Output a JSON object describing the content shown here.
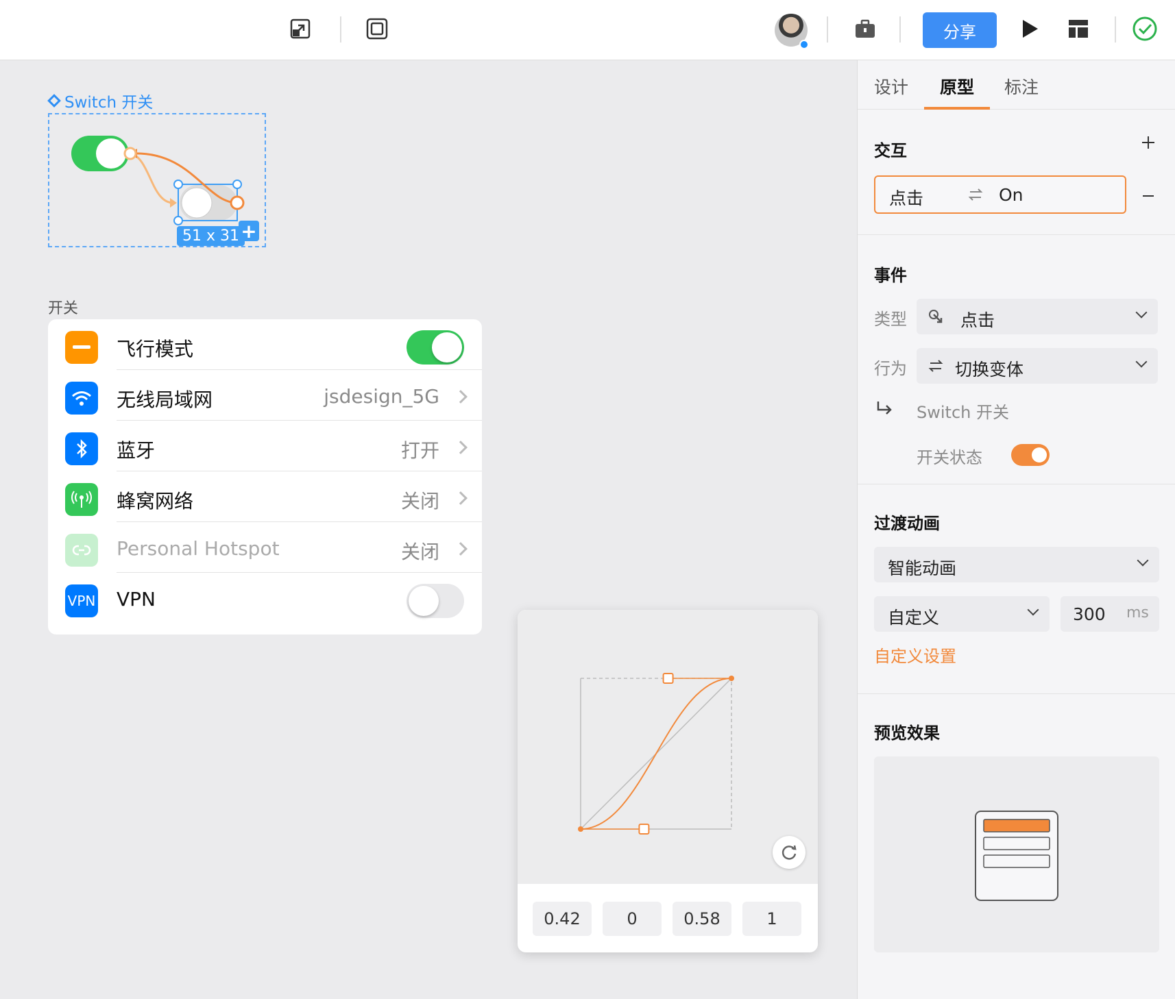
{
  "toolbar": {
    "share_label": "分享",
    "icons": [
      "resize-icon",
      "frame-icon",
      "briefcase-icon",
      "play-icon",
      "layout-icon",
      "check-circle-icon"
    ]
  },
  "canvas": {
    "frame_label": "Switch 开关",
    "size_badge": "51 x 31",
    "section_title": "开关",
    "rows": [
      {
        "label": "飞行模式",
        "value": "",
        "icon": "airplane-icon",
        "color": "#ff9500"
      },
      {
        "label": "无线局域网",
        "value": "jsdesign_5G",
        "icon": "wifi-icon",
        "color": "#007aff"
      },
      {
        "label": "蓝牙",
        "value": "打开",
        "icon": "bluetooth-icon",
        "color": "#007aff"
      },
      {
        "label": "蜂窝网络",
        "value": "关闭",
        "icon": "cellular-icon",
        "color": "#34c759"
      },
      {
        "label": "Personal Hotspot",
        "value": "关闭",
        "icon": "hotspot-icon",
        "color": "#c7f0cf"
      },
      {
        "label": "VPN",
        "value": "",
        "icon": "vpn-icon",
        "color": "#007aff",
        "icon_text": "VPN"
      }
    ]
  },
  "bezier": {
    "coefficients": [
      "0.42",
      "0",
      "0.58",
      "1"
    ]
  },
  "panel": {
    "tabs": [
      "设计",
      "原型",
      "标注"
    ],
    "active_tab": "原型",
    "interaction": {
      "heading": "交互",
      "trigger": "点击",
      "target": "On"
    },
    "event": {
      "heading": "事件",
      "type_label": "类型",
      "type_value": "点击",
      "action_label": "行为",
      "action_value": "切换变体",
      "component": "Switch 开关",
      "state_label": "开关状态"
    },
    "transition": {
      "heading": "过渡动画",
      "animation": "智能动画",
      "easing": "自定义",
      "duration": "300",
      "unit": "ms",
      "custom_link": "自定义设置"
    },
    "preview": {
      "heading": "预览效果"
    }
  },
  "colors": {
    "accent": "#f2893b",
    "primary": "#3d8ef5",
    "switch_on": "#34c759"
  }
}
